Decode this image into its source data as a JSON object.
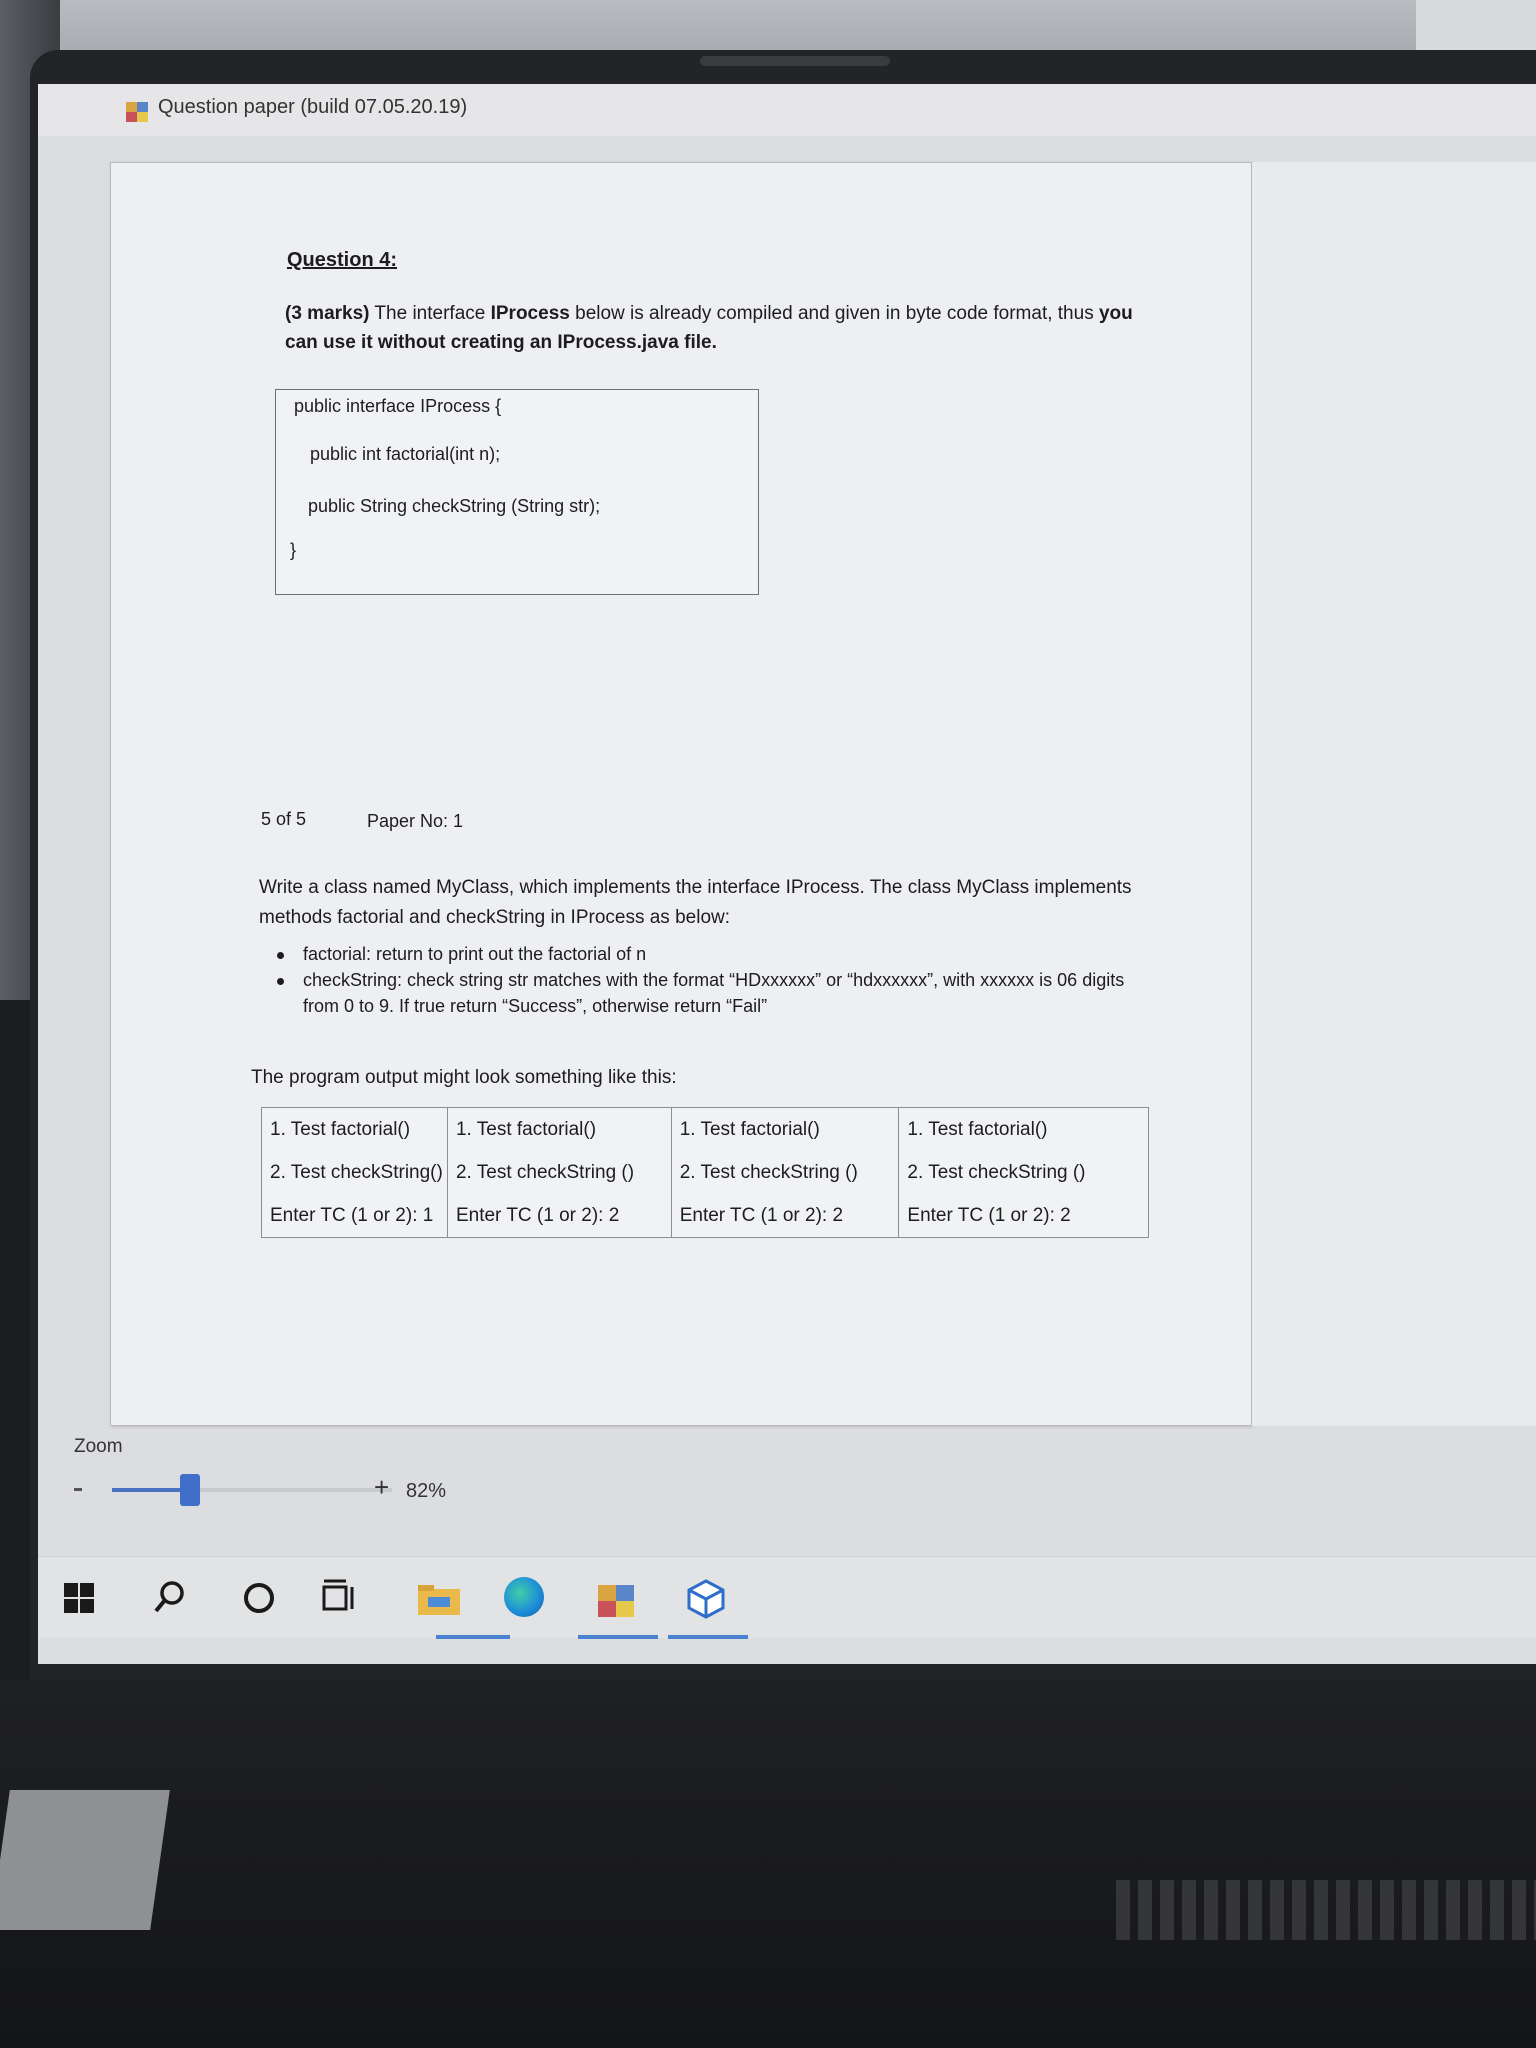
{
  "window": {
    "title": "Question paper (build 07.05.20.19)"
  },
  "question": {
    "heading": "Question 4:",
    "intro_marks": "(3 marks)",
    "intro_part1": " The interface ",
    "intro_iface": "IProcess",
    "intro_part2": " below is already compiled and given in byte code format, thus ",
    "intro_bold_end": "you can use it without creating an IProcess.java file.",
    "code": [
      "public interface IProcess {",
      "public int factorial(int n);",
      "public String checkString (String str);",
      "}"
    ],
    "page_indicator": "5 of 5",
    "paper_no": "Paper No: 1",
    "task": "Write a class named MyClass, which implements the interface IProcess. The class MyClass implements methods  factorial and checkString in IProcess as below:",
    "bullets": [
      "factorial: return to print out the factorial of n",
      "checkString: check string str matches with the format “HDxxxxxx” or “hdxxxxxx”, with xxxxxx is 06 digits from 0 to 9. If true return “Success”, otherwise return “Fail”"
    ],
    "output_label": "The program output might look something like this:",
    "output_table": [
      [
        "1. Test factorial()",
        "2. Test checkString()",
        "Enter TC (1 or 2): 1"
      ],
      [
        "1. Test factorial()",
        "2. Test checkString ()",
        "Enter TC (1 or 2): 2"
      ],
      [
        "1. Test factorial()",
        "2. Test checkString ()",
        "Enter TC (1 or 2): 2"
      ],
      [
        "1. Test factorial()",
        "2. Test checkString ()",
        "Enter TC (1 or 2): 2"
      ]
    ]
  },
  "zoom": {
    "label": "Zoom",
    "minus": "-",
    "plus": "+",
    "value": "82%",
    "level": 0.82
  },
  "taskbar": {
    "icons": [
      "windows-start-icon",
      "search-icon",
      "cortana-icon",
      "task-view-icon",
      "file-explorer-icon",
      "edge-browser-icon",
      "question-paper-app-icon",
      "3d-cube-app-icon"
    ]
  },
  "colors": {
    "accent": "#3f6fc9",
    "page_bg": "#eeeff1",
    "bezel": "#232427"
  }
}
